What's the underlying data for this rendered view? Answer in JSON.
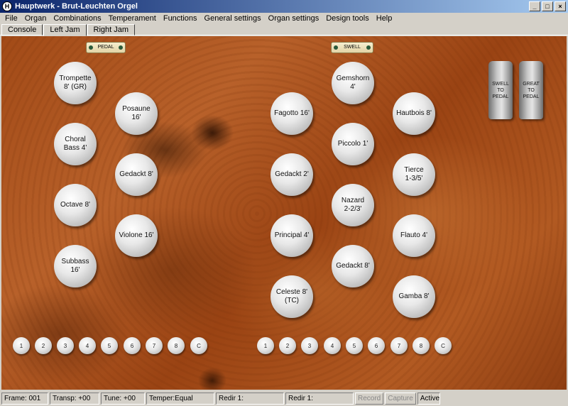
{
  "window": {
    "title": "Hauptwerk - Brut-Leuchten Orgel",
    "icon": "hauptwerk-icon"
  },
  "menu": [
    "File",
    "Organ",
    "Combinations",
    "Temperament",
    "Functions",
    "General settings",
    "Organ settings",
    "Design tools",
    "Help"
  ],
  "tabs": [
    {
      "label": "Console",
      "active": false
    },
    {
      "label": "Left Jam",
      "active": true
    },
    {
      "label": "Right Jam",
      "active": false
    }
  ],
  "plates": {
    "pedal": "PEDAL",
    "swell": "SWELL"
  },
  "stops": {
    "pedal_col1": [
      "Trompette\n8' (GR)",
      "Choral\nBass 4'",
      "Octave 8'",
      "Subbass\n16'"
    ],
    "pedal_col2": [
      "Posaune\n16'",
      "Gedackt 8'",
      "Violone 16'"
    ],
    "swell_col1": [
      "Fagotto 16'",
      "Gedackt 2'",
      "Principal 4'",
      "Celeste 8'\n(TC)"
    ],
    "swell_col2": [
      "Gemshorn\n4'",
      "Piccolo 1'",
      "Nazard\n2-2/3'",
      "Gedackt 8'"
    ],
    "swell_col3": [
      "Hautbois 8'",
      "Tierce\n1-3/5'",
      "Flauto 4'",
      "Gamba 8'"
    ]
  },
  "couplers": [
    "SWELL\nTO\nPEDAL",
    "GREAT\nTO\nPEDAL"
  ],
  "pistons_left": [
    "1",
    "2",
    "3",
    "4",
    "5",
    "6",
    "7",
    "8",
    "C"
  ],
  "pistons_right": [
    "1",
    "2",
    "3",
    "4",
    "5",
    "6",
    "7",
    "8",
    "C"
  ],
  "status": {
    "frame": "Frame: 001",
    "transp": "Transp: +00",
    "tune": "Tune: +00",
    "temper": "Temper:Equal",
    "redir1": "Redir 1:",
    "redir2": "Redir 1:",
    "record": "Record",
    "capture": "Capture",
    "active": "Active"
  }
}
